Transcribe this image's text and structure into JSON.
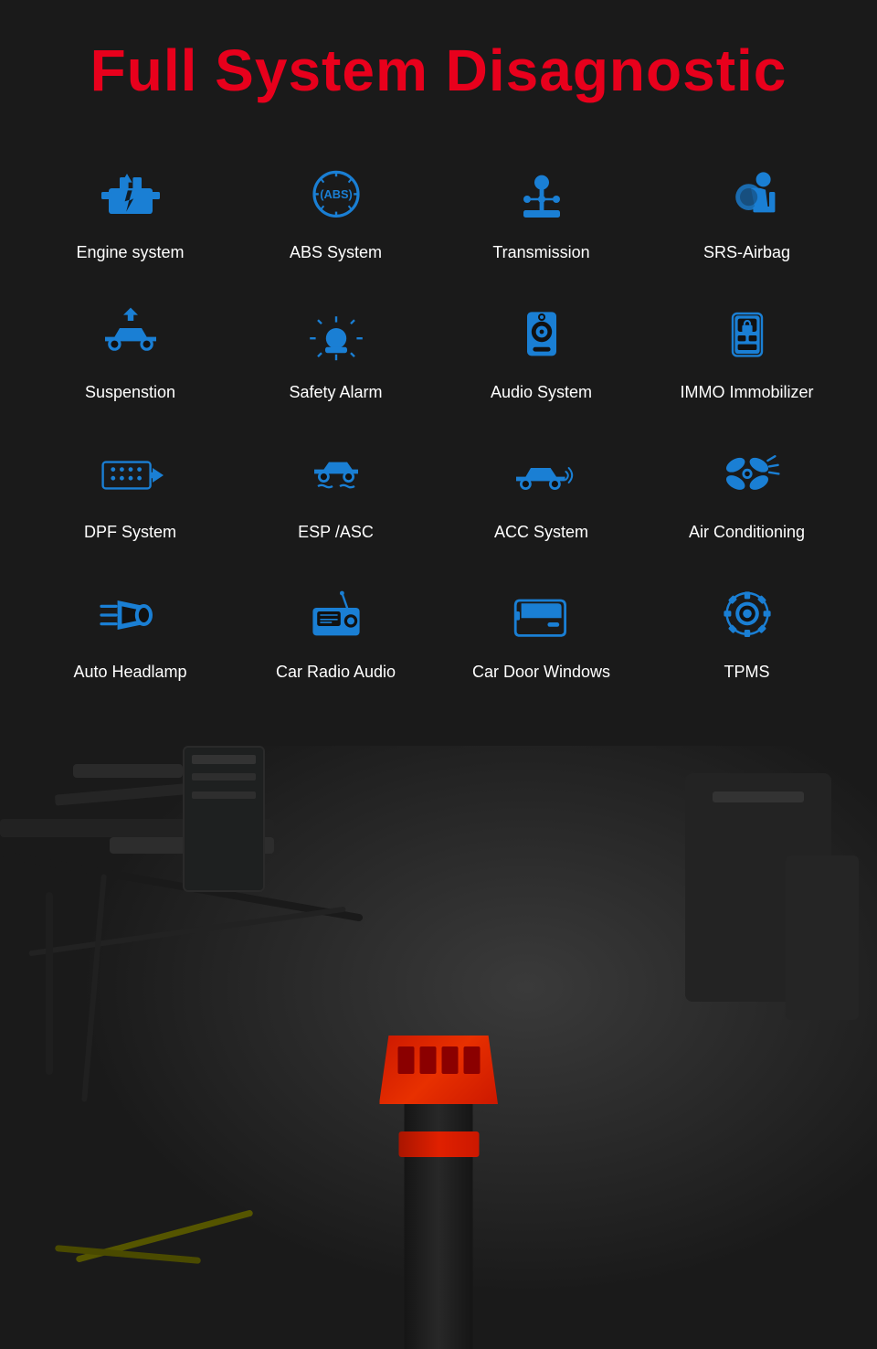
{
  "title": "Full System Disagnostic",
  "accent_color": "#e8001c",
  "icon_color": "#1a7fd4",
  "items": [
    {
      "id": "engine-system",
      "label": "Engine system",
      "icon": "engine"
    },
    {
      "id": "abs-system",
      "label": "ABS System",
      "icon": "abs"
    },
    {
      "id": "transmission",
      "label": "Transmission",
      "icon": "transmission"
    },
    {
      "id": "srs-airbag",
      "label": "SRS-Airbag",
      "icon": "airbag"
    },
    {
      "id": "suspension",
      "label": "Suspenstion",
      "icon": "suspension"
    },
    {
      "id": "safety-alarm",
      "label": "Safety Alarm",
      "icon": "alarm"
    },
    {
      "id": "audio-system",
      "label": "Audio System",
      "icon": "audio"
    },
    {
      "id": "immo-immobilizer",
      "label": "IMMO Immobilizer",
      "icon": "immo"
    },
    {
      "id": "dpf-system",
      "label": "DPF System",
      "icon": "dpf"
    },
    {
      "id": "esp-asc",
      "label": "ESP /ASC",
      "icon": "esp"
    },
    {
      "id": "acc-system",
      "label": "ACC System",
      "icon": "acc"
    },
    {
      "id": "air-conditioning",
      "label": "Air Conditioning",
      "icon": "aircon"
    },
    {
      "id": "auto-headlamp",
      "label": "Auto Headlamp",
      "icon": "headlamp"
    },
    {
      "id": "car-radio-audio",
      "label": "Car Radio Audio",
      "icon": "radioaudio"
    },
    {
      "id": "car-door-windows",
      "label": "Car Door Windows",
      "icon": "doorwindow"
    },
    {
      "id": "tpms",
      "label": "TPMS",
      "icon": "tpms"
    }
  ]
}
